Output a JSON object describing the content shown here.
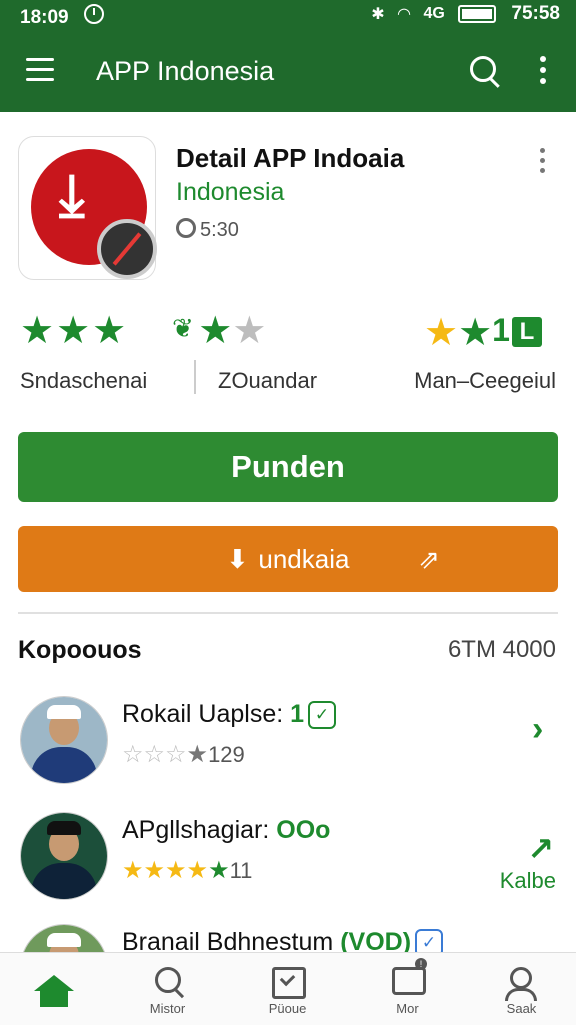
{
  "status": {
    "time": "18:09",
    "right_time": "75:58",
    "signal": "4G"
  },
  "appbar": {
    "title": "APP Indonesia"
  },
  "detail": {
    "title": "Detail APP Indoaia",
    "subtitle": "Indonesia",
    "time": "5:30"
  },
  "ratings": {
    "left_label": "Sndaschenai",
    "mid_label": "ZOuandar",
    "right_label": "Man–Ceegeiul",
    "right_number": "1"
  },
  "buttons": {
    "primary": "Punden",
    "secondary": "undkaia"
  },
  "section": {
    "title": "Kopoouos",
    "count": "6TM 4000"
  },
  "list": [
    {
      "name": "Rokail Uaplse:",
      "tag": "1",
      "rating": "129"
    },
    {
      "name": "APgllshagiar:",
      "tag": "OOo",
      "rating": "11",
      "action": "Kalbe"
    },
    {
      "name": "Branail Bdhnestum",
      "tag": "(VOD)"
    }
  ],
  "nav": [
    {
      "label": ""
    },
    {
      "label": "Mistor"
    },
    {
      "label": "Püoue"
    },
    {
      "label": "Mor"
    },
    {
      "label": "Saak"
    }
  ],
  "colors": {
    "brand_green": "#1f6a2c",
    "button_green": "#2e8b32",
    "accent_orange": "#df7a16",
    "app_red": "#c8161c"
  }
}
